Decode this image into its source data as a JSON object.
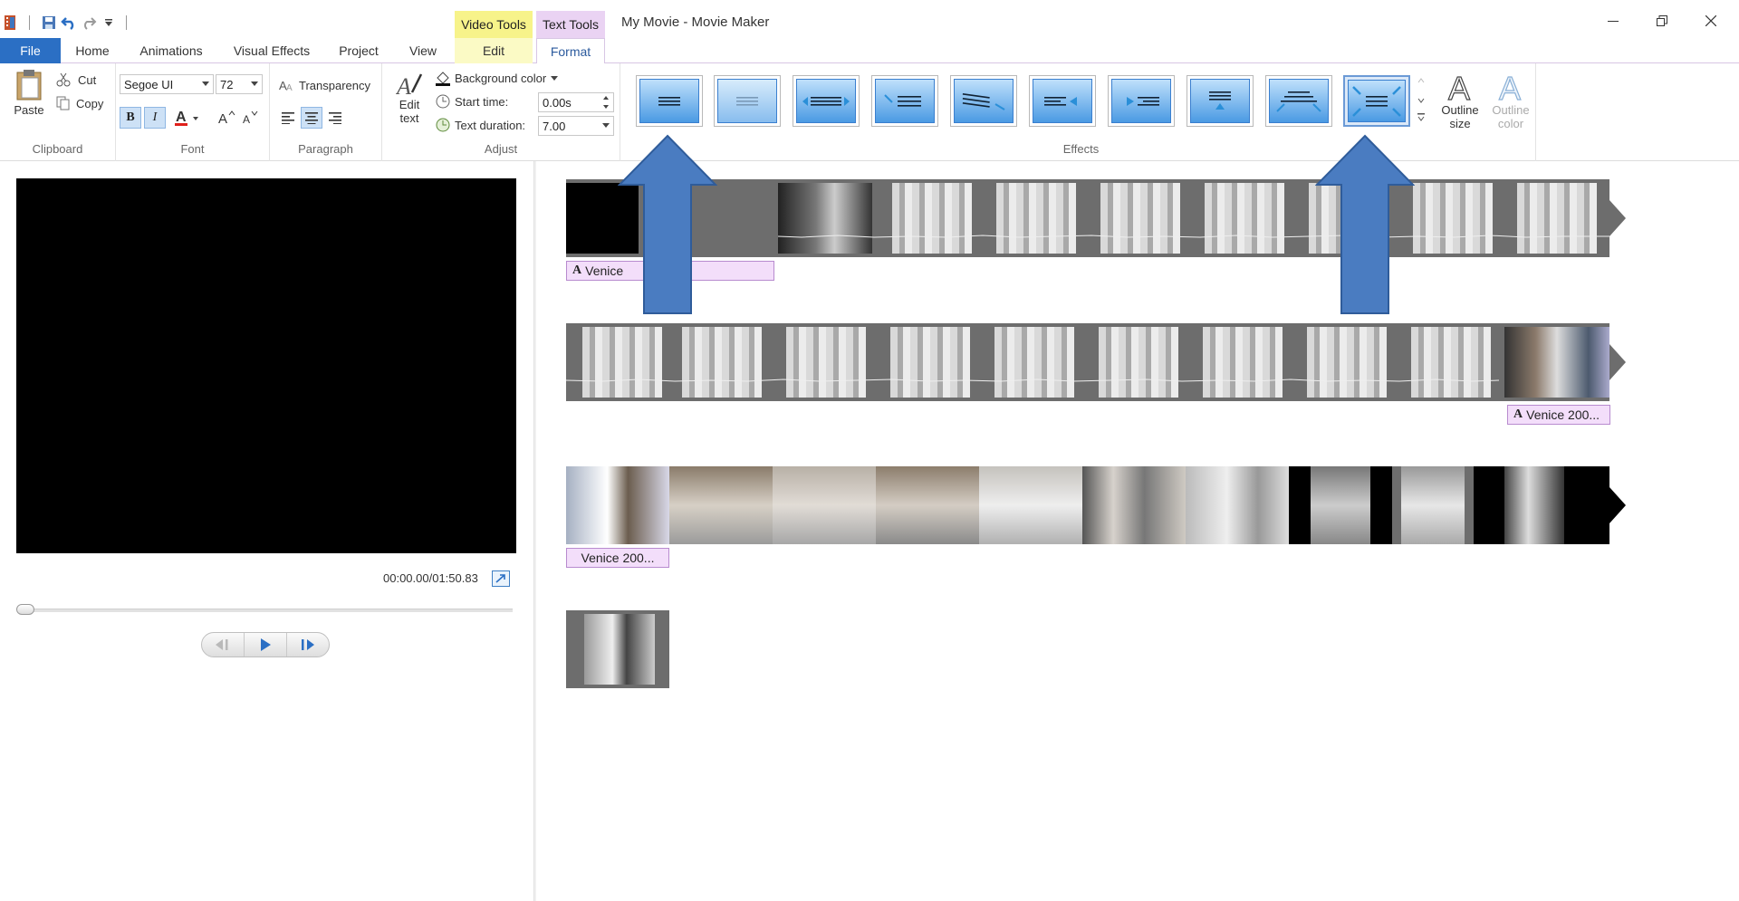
{
  "window": {
    "title": "My Movie - Movie Maker",
    "context_tabs": {
      "video": "Video Tools",
      "text": "Text Tools"
    }
  },
  "tabs": {
    "file": "File",
    "home": "Home",
    "animations": "Animations",
    "visual_effects": "Visual Effects",
    "project": "Project",
    "view": "View",
    "edit": "Edit",
    "format": "Format"
  },
  "ribbon": {
    "clipboard": {
      "label": "Clipboard",
      "paste": "Paste",
      "cut": "Cut",
      "copy": "Copy"
    },
    "font": {
      "label": "Font",
      "family": "Segoe UI",
      "size": "72",
      "bold": "B",
      "italic": "I",
      "font_color": "A"
    },
    "paragraph": {
      "label": "Paragraph",
      "transparency": "Transparency"
    },
    "adjust": {
      "label": "Adjust",
      "edit_text": "Edit text",
      "background_color": "Background color",
      "start_time_label": "Start time:",
      "start_time_value": "0.00s",
      "text_duration_label": "Text duration:",
      "text_duration_value": "7.00"
    },
    "effects": {
      "label": "Effects",
      "outline_size": "Outline size",
      "outline_color": "Outline color"
    }
  },
  "player": {
    "timecode": "00:00.00/01:50.83"
  },
  "storyboard": {
    "captions": [
      "Venice",
      "Venice 200...",
      "Venice 200..."
    ]
  },
  "colors": {
    "file_tab": "#2b6fc4",
    "video_tools": "#f7f38a",
    "text_tools": "#ead3f3",
    "caption_bg": "#f3defa",
    "annotation_arrow": "#4a7cc1"
  }
}
